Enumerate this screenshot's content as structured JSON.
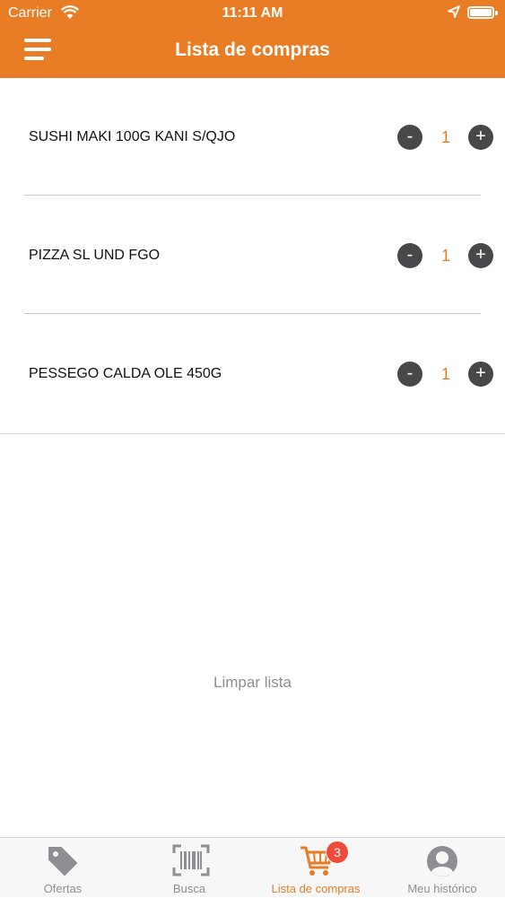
{
  "status_bar": {
    "carrier": "Carrier",
    "time": "11:11 AM"
  },
  "header": {
    "title": "Lista de compras"
  },
  "items": [
    {
      "name": "SUSHI MAKI 100G KANI S/QJO",
      "qty": "1",
      "minus": "-",
      "plus": "+"
    },
    {
      "name": "PIZZA SL UND FGO",
      "qty": "1",
      "minus": "-",
      "plus": "+"
    },
    {
      "name": "PESSEGO CALDA OLE 450G",
      "qty": "1",
      "minus": "-",
      "plus": "+"
    }
  ],
  "clear_label": "Limpar lista",
  "tabs": [
    {
      "label": "Ofertas",
      "icon": "tag-icon",
      "active": false
    },
    {
      "label": "Busca",
      "icon": "barcode-icon",
      "active": false
    },
    {
      "label": "Lista de compras",
      "icon": "cart-icon",
      "active": true,
      "badge": "3"
    },
    {
      "label": "Meu histórico",
      "icon": "user-icon",
      "active": false
    }
  ],
  "colors": {
    "accent": "#e87d26",
    "button": "#48484a",
    "badge": "#f04a3a",
    "inactive": "#8e8e93"
  }
}
